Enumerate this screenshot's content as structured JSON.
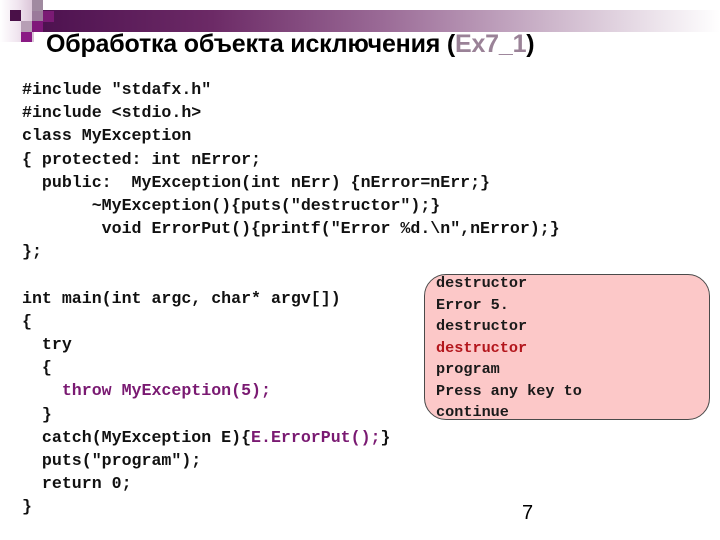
{
  "slide": {
    "title_main": "Обработка объекта исключения (",
    "title_code": "Ex7_1",
    "title_close": ")",
    "page_number": "7",
    "colors": {
      "accent_purple": "#7a1a72",
      "title_code_grey": "#9a8297",
      "console_bg": "#fcc8c8",
      "console_highlight_red": "#b3161c"
    }
  },
  "code": {
    "lines": [
      "#include \"stdafx.h\"",
      "#include <stdio.h>",
      "class MyException",
      "{ protected: int nError;",
      "  public:  MyException(int nErr) {nError=nErr;}",
      "       ~MyException(){puts(\"destructor\");}",
      "        void ErrorPut(){printf(\"Error %d.\\n\",nError);}",
      "};",
      "",
      "int main(int argc, char* argv[])",
      "{",
      "  try",
      "  {",
      "    throw MyException(5);",
      "  }",
      "  catch(MyException E){",
      "  puts(\"program\");",
      "  return 0;",
      "}"
    ],
    "catch_highlight": "E.ErrorPut();",
    "catch_tail": "}"
  },
  "console": {
    "lines": [
      "destructor",
      "Error 5.",
      "destructor",
      "destructor",
      "program",
      "Press any key to",
      "continue"
    ]
  }
}
